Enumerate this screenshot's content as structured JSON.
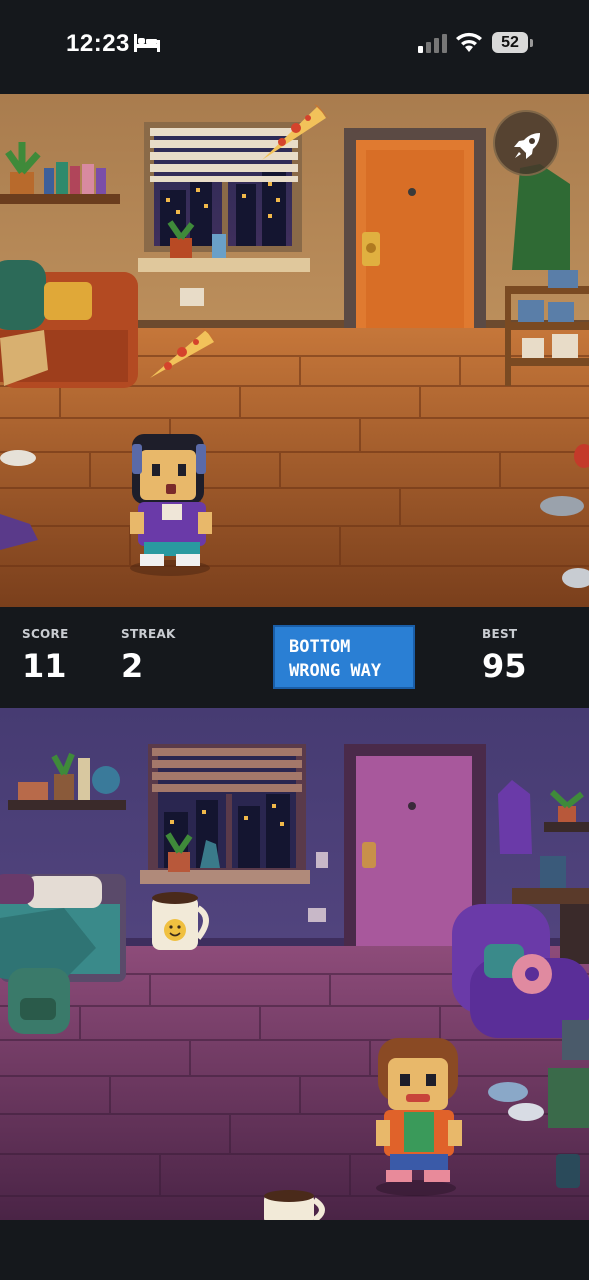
{
  "status_bar": {
    "time": "12:23",
    "battery_level": "52",
    "icons": [
      "bed-icon",
      "signal-icon",
      "wifi-icon",
      "battery-icon"
    ]
  },
  "hud": {
    "score_label": "SCORE",
    "score_value": "11",
    "streak_label": "STREAK",
    "streak_value": "2",
    "banner_line1": "BOTTOM",
    "banner_line2": "WRONG WAY",
    "best_label": "BEST",
    "best_value": "95"
  },
  "boost_button": {
    "icon": "rocket-icon"
  },
  "colors": {
    "top_room_wall": "#c89a62",
    "top_room_floor": "#b8662c",
    "bottom_room_wall": "#5a4a86",
    "bottom_room_floor": "#7a3f6a",
    "banner": "#2a7fd4",
    "hud_background": "#15181c"
  }
}
